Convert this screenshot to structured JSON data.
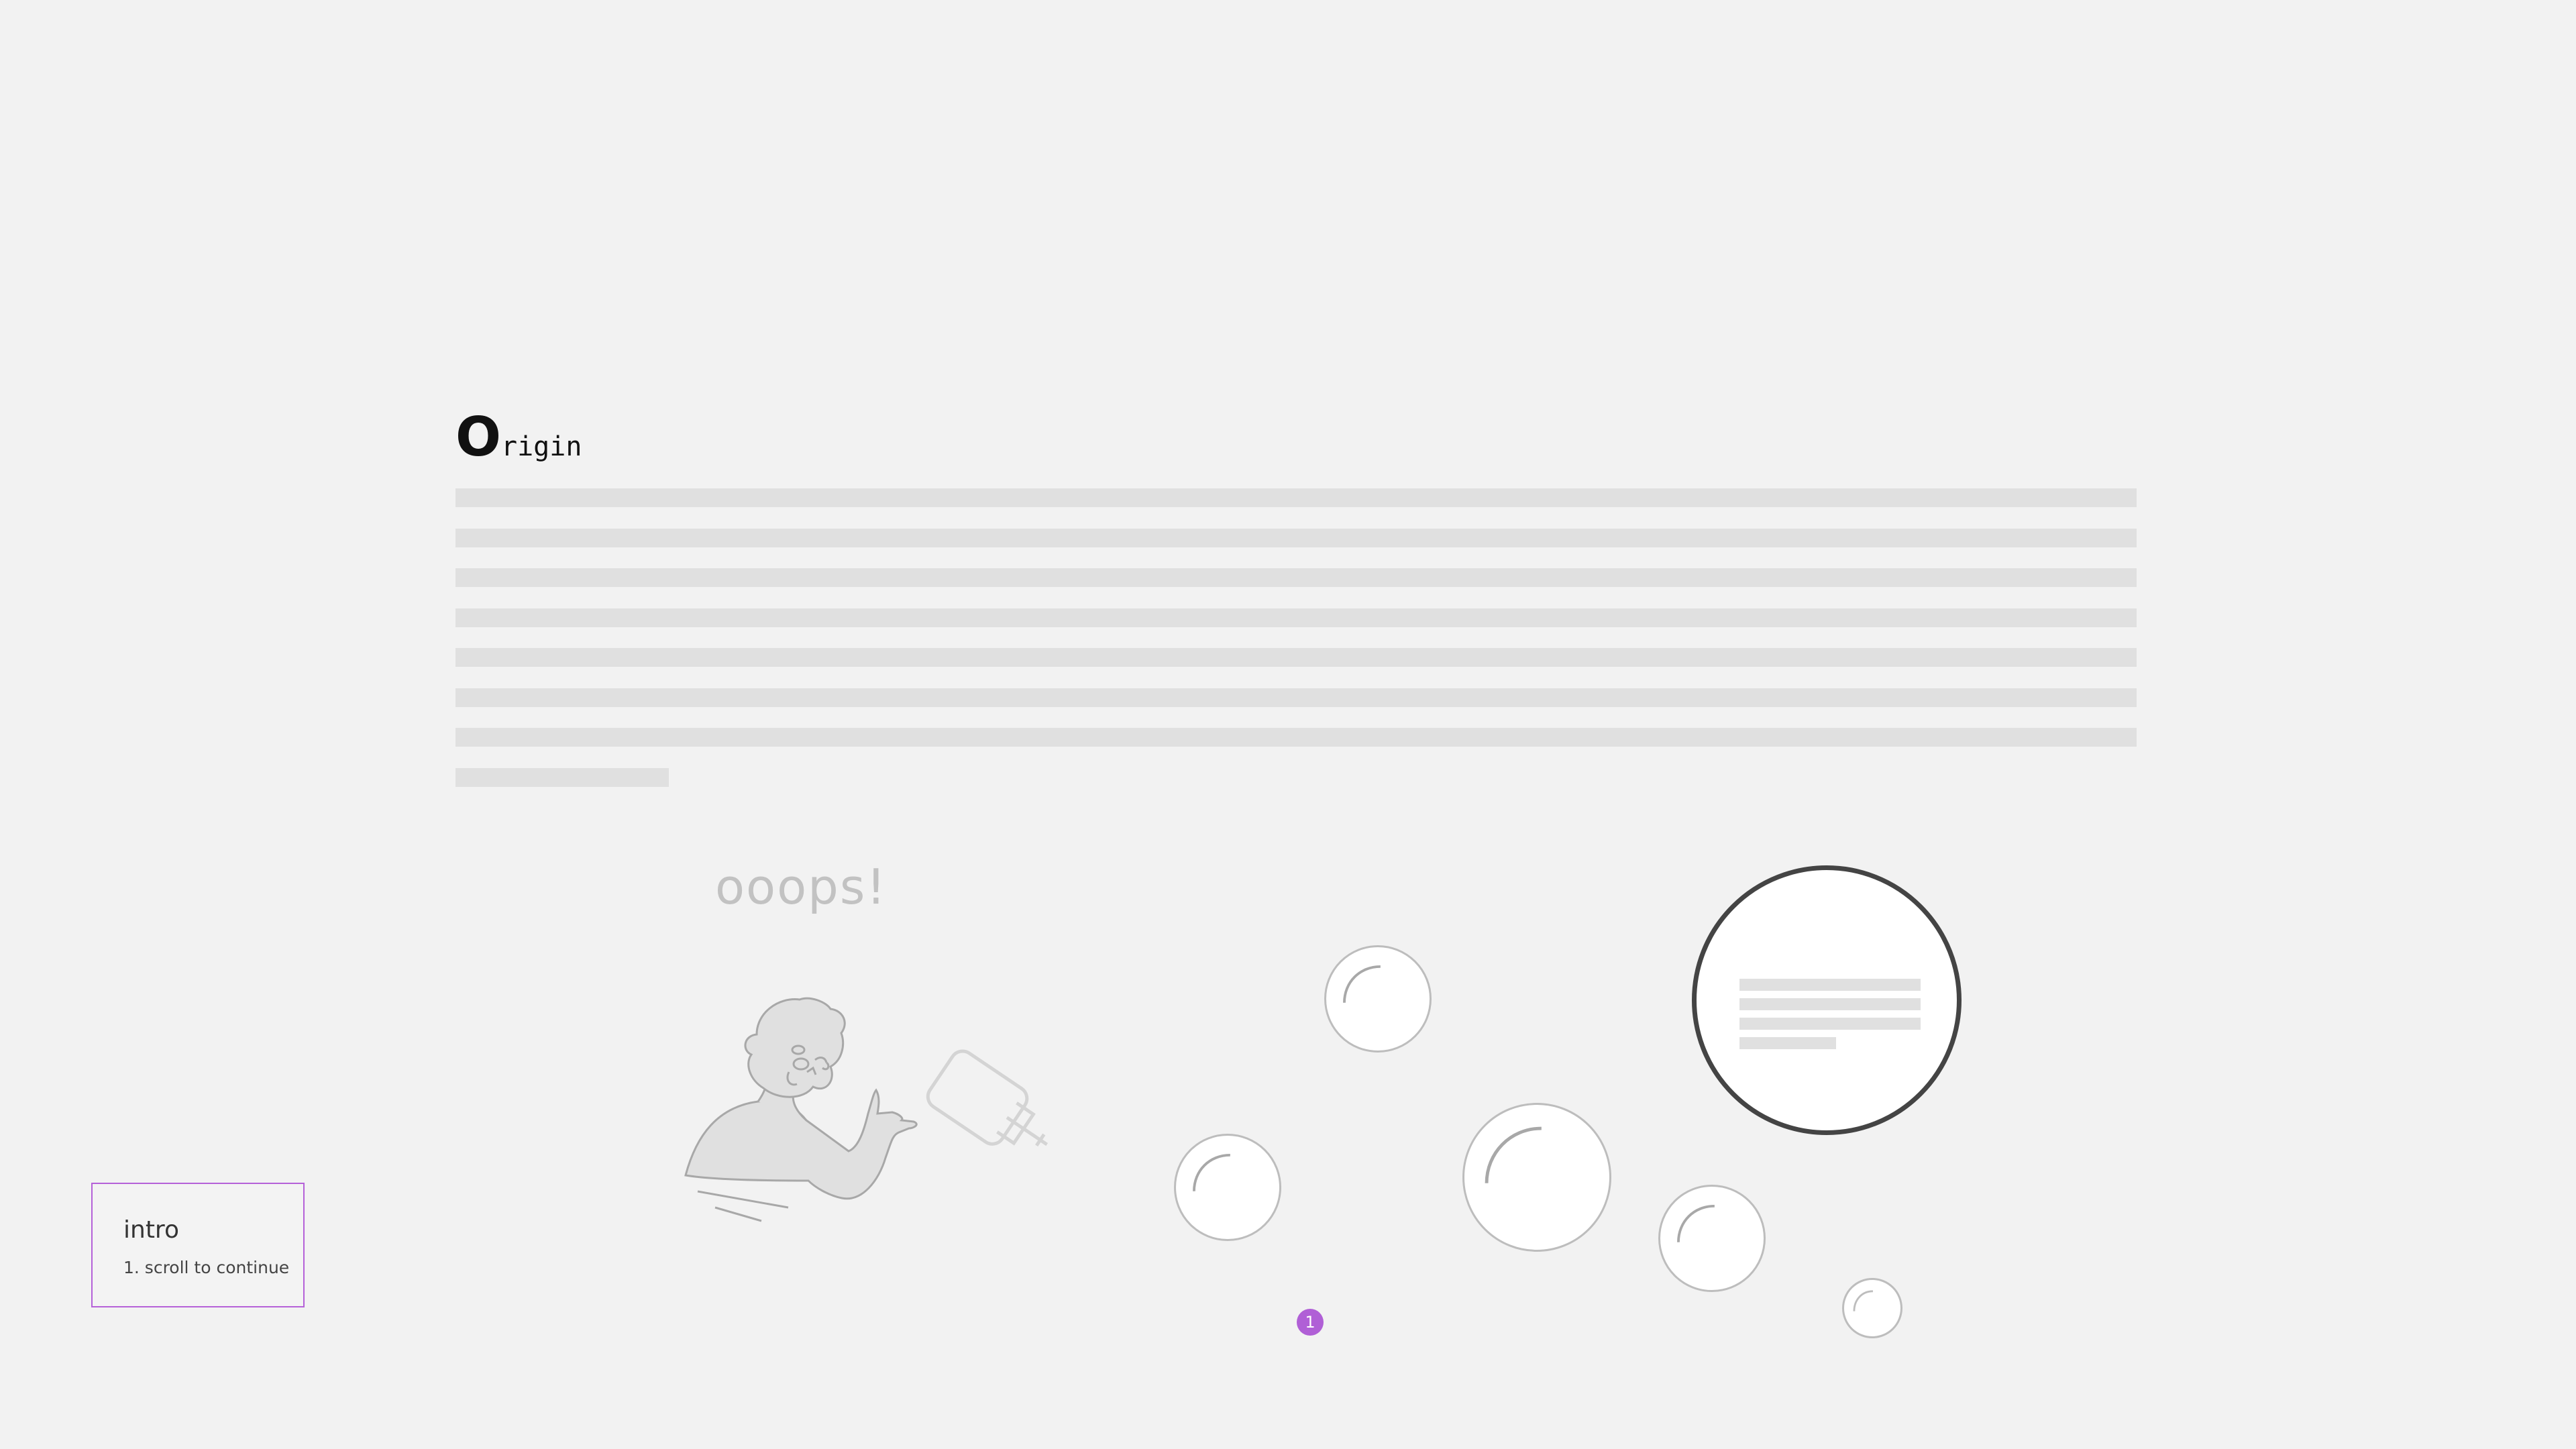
{
  "header": {
    "title_initial": "O",
    "title_rest": "rigin"
  },
  "error": {
    "text": "ooops!"
  },
  "intro": {
    "title": "intro",
    "step": "1. scroll to continue"
  },
  "pagination": {
    "current": "1"
  },
  "colors": {
    "accent": "#b05fd6",
    "background": "#f2f2f2",
    "placeholder": "#e0e0e0",
    "bubble_border": "#bdbdbd",
    "main_bubble_border": "#444444"
  },
  "icons": {
    "illustration": "person-spilled-drink-illustration"
  }
}
